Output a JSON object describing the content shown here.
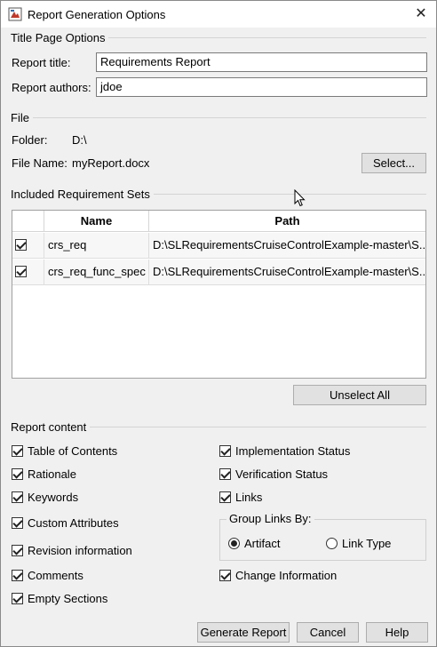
{
  "window": {
    "title": "Report Generation Options",
    "close_glyph": "✕"
  },
  "title_page": {
    "section": "Title Page Options",
    "report_title_label": "Report title:",
    "report_title_value": "Requirements Report",
    "report_authors_label": "Report authors:",
    "report_authors_value": "jdoe"
  },
  "file": {
    "section": "File",
    "folder_label": "Folder:",
    "folder_value": "D:\\",
    "filename_label": "File Name:",
    "filename_value": "myReport.docx",
    "select_button": "Select..."
  },
  "req_sets": {
    "section": "Included Requirement Sets",
    "columns": [
      "",
      "Name",
      "Path"
    ],
    "rows": [
      {
        "checked": true,
        "name": "crs_req",
        "path": "D:\\SLRequirementsCruiseControlExample-master\\S..."
      },
      {
        "checked": true,
        "name": "crs_req_func_spec",
        "path": "D:\\SLRequirementsCruiseControlExample-master\\S..."
      }
    ],
    "unselect_all_button": "Unselect All"
  },
  "report_content": {
    "section": "Report content",
    "left_options": [
      {
        "label": "Table of Contents",
        "checked": true
      },
      {
        "label": "Rationale",
        "checked": true
      },
      {
        "label": "Keywords",
        "checked": true
      },
      {
        "label": "Custom Attributes",
        "checked": true
      },
      {
        "label": "Revision information",
        "checked": true
      },
      {
        "label": "Comments",
        "checked": true
      },
      {
        "label": "Empty Sections",
        "checked": true
      }
    ],
    "right_options": [
      {
        "label": "Implementation Status",
        "checked": true
      },
      {
        "label": "Verification Status",
        "checked": true
      },
      {
        "label": "Links",
        "checked": true
      }
    ],
    "group_links_by": {
      "label": "Group Links By:",
      "options": [
        {
          "label": "Artifact",
          "selected": true
        },
        {
          "label": "Link Type",
          "selected": false
        }
      ]
    },
    "change_information": {
      "label": "Change Information",
      "checked": true
    }
  },
  "footer": {
    "generate_button": "Generate Report",
    "cancel_button": "Cancel",
    "help_button": "Help"
  }
}
